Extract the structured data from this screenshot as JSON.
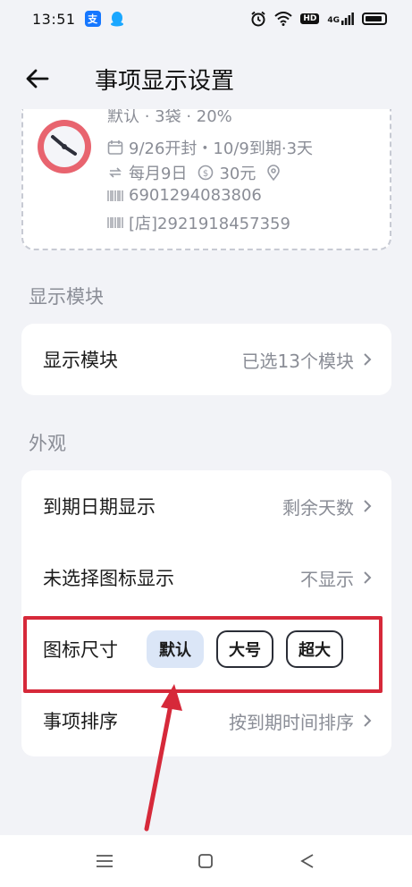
{
  "status": {
    "time": "13:51",
    "alipay_badge": "支",
    "hd_badge": "HD",
    "signal_text": "4G"
  },
  "header": {
    "title": "事项显示设置"
  },
  "preview": {
    "line0": "默认 · 3袋 · 20%",
    "line1": "9/26开封・10/9到期·3天",
    "line2a": "每月9日",
    "line2b": "30元",
    "line3": "6901294083806",
    "line4": "[店]2921918457359"
  },
  "section_display": {
    "label": "显示模块",
    "row_label": "显示模块",
    "row_value": "已选13个模块"
  },
  "section_appearance": {
    "label": "外观",
    "rows": [
      {
        "label": "到期日期显示",
        "value": "剩余天数"
      },
      {
        "label": "未选择图标显示",
        "value": "不显示"
      },
      {
        "label": "图标尺寸"
      },
      {
        "label": "事项排序",
        "value": "按到期时间排序"
      }
    ],
    "icon_size_options": [
      "默认",
      "大号",
      "超大"
    ],
    "icon_size_selected": 0
  },
  "colors": {
    "accent_selected": "#dbe6f7",
    "highlight": "#d6293a",
    "arrow": "#d6293a"
  }
}
